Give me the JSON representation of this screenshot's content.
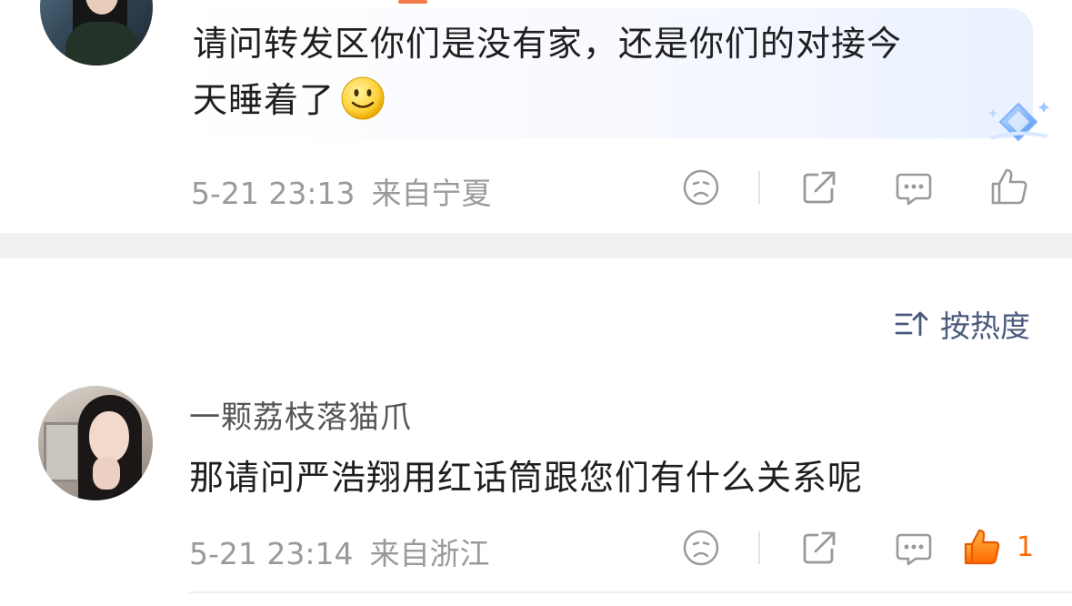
{
  "comments": [
    {
      "text_line1": "请问转发区你们是没有家，还是你们的对接今",
      "text_line2": "天睡着了",
      "time": "5-21 23:13",
      "location": "来自宁夏"
    },
    {
      "username": "一颗荔枝落猫爪",
      "text": "那请问严浩翔用红话筒跟您们有什么关系呢",
      "time": "5-21 23:14",
      "location": "来自浙江",
      "like_count": "1"
    }
  ],
  "sort": {
    "label": "按热度"
  },
  "icons": [
    "sad-face-icon",
    "share-icon",
    "comment-icon",
    "thumbs-up-icon"
  ],
  "colors": {
    "accent": "#ff6a00",
    "sort_text": "#4a5a7e",
    "meta_text": "#9a9a9a"
  }
}
